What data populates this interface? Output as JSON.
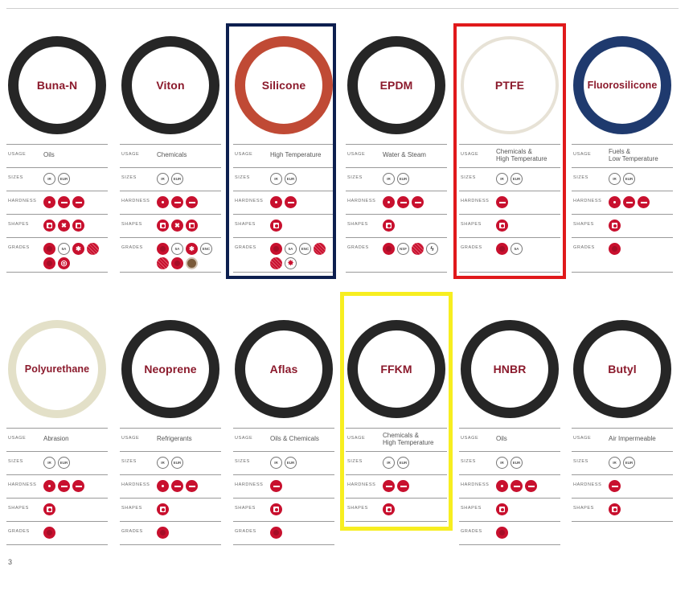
{
  "labels": {
    "usage": "USAGE",
    "sizes": "SIZES",
    "hardness": "HARDNESS",
    "shapes": "SHAPES",
    "grades": "GRADES",
    "size_a": "IR",
    "size_b": "EUR"
  },
  "page_number": "3",
  "colors": {
    "accent": "#c8102e",
    "title": "#8b1a2c",
    "ring_black": "#262626",
    "silicone": "#c04a35",
    "ptfe": "#e7e2d6",
    "fluorosilicone": "#1f3a6e",
    "polyurethane": "#e3e0c8"
  },
  "materials": [
    {
      "name": "Buna-N",
      "usage": [
        "Oils"
      ],
      "hardness": [
        "dot",
        "dash",
        "dash"
      ],
      "shapes": [
        "circle",
        "x",
        "square"
      ],
      "grades": [
        "plain",
        "5A",
        "star",
        "striped",
        "plain",
        "swirl"
      ]
    },
    {
      "name": "Viton",
      "usage": [
        "Chemicals"
      ],
      "hardness": [
        "dot",
        "dash",
        "dash"
      ],
      "shapes": [
        "circle",
        "x",
        "square"
      ],
      "grades": [
        "plain",
        "5A",
        "star",
        "ENC",
        "striped",
        "plain",
        "brown"
      ]
    },
    {
      "name": "Silicone",
      "usage": [
        "High Temperature"
      ],
      "hardness": [
        "dot",
        "dash"
      ],
      "shapes": [
        "circle"
      ],
      "grades": [
        "plain",
        "5A",
        "ENC",
        "striped",
        "striped",
        "starburst"
      ]
    },
    {
      "name": "EPDM",
      "usage": [
        "Water & Steam"
      ],
      "hardness": [
        "dot",
        "dash",
        "dash"
      ],
      "shapes": [
        "circle"
      ],
      "grades": [
        "plain",
        "NSF",
        "striped",
        "bolt"
      ]
    },
    {
      "name": "PTFE",
      "usage": [
        "Chemicals &",
        "High Temperature"
      ],
      "hardness": [
        "dash"
      ],
      "shapes": [
        "circle"
      ],
      "grades": [
        "plain",
        "5A"
      ]
    },
    {
      "name": "Fluorosilicone",
      "usage": [
        "Fuels &",
        "Low Temperature"
      ],
      "hardness": [
        "dot",
        "dash",
        "dash"
      ],
      "shapes": [
        "circle"
      ],
      "grades": [
        "plain"
      ]
    },
    {
      "name": "Polyurethane",
      "usage": [
        "Abrasion"
      ],
      "hardness": [
        "dot",
        "dash",
        "dash"
      ],
      "shapes": [
        "circle"
      ],
      "grades": [
        "plain"
      ]
    },
    {
      "name": "Neoprene",
      "usage": [
        "Refrigerants"
      ],
      "hardness": [
        "dot",
        "dash",
        "dash"
      ],
      "shapes": [
        "circle"
      ],
      "grades": [
        "plain"
      ]
    },
    {
      "name": "Aflas",
      "usage": [
        "Oils & Chemicals"
      ],
      "hardness": [
        "dash"
      ],
      "shapes": [
        "circle"
      ],
      "grades": [
        "plain"
      ]
    },
    {
      "name": "FFKM",
      "usage": [
        "Chemicals &",
        "High Temperature"
      ],
      "hardness": [
        "dash",
        "dash"
      ],
      "shapes": [
        "circle"
      ],
      "grades": []
    },
    {
      "name": "HNBR",
      "usage": [
        "Oils"
      ],
      "hardness": [
        "dot",
        "dash",
        "dash"
      ],
      "shapes": [
        "circle"
      ],
      "grades": [
        "plain"
      ]
    },
    {
      "name": "Butyl",
      "usage": [
        "Air Impermeable"
      ],
      "hardness": [
        "dash"
      ],
      "shapes": [
        "circle"
      ],
      "grades": []
    }
  ]
}
